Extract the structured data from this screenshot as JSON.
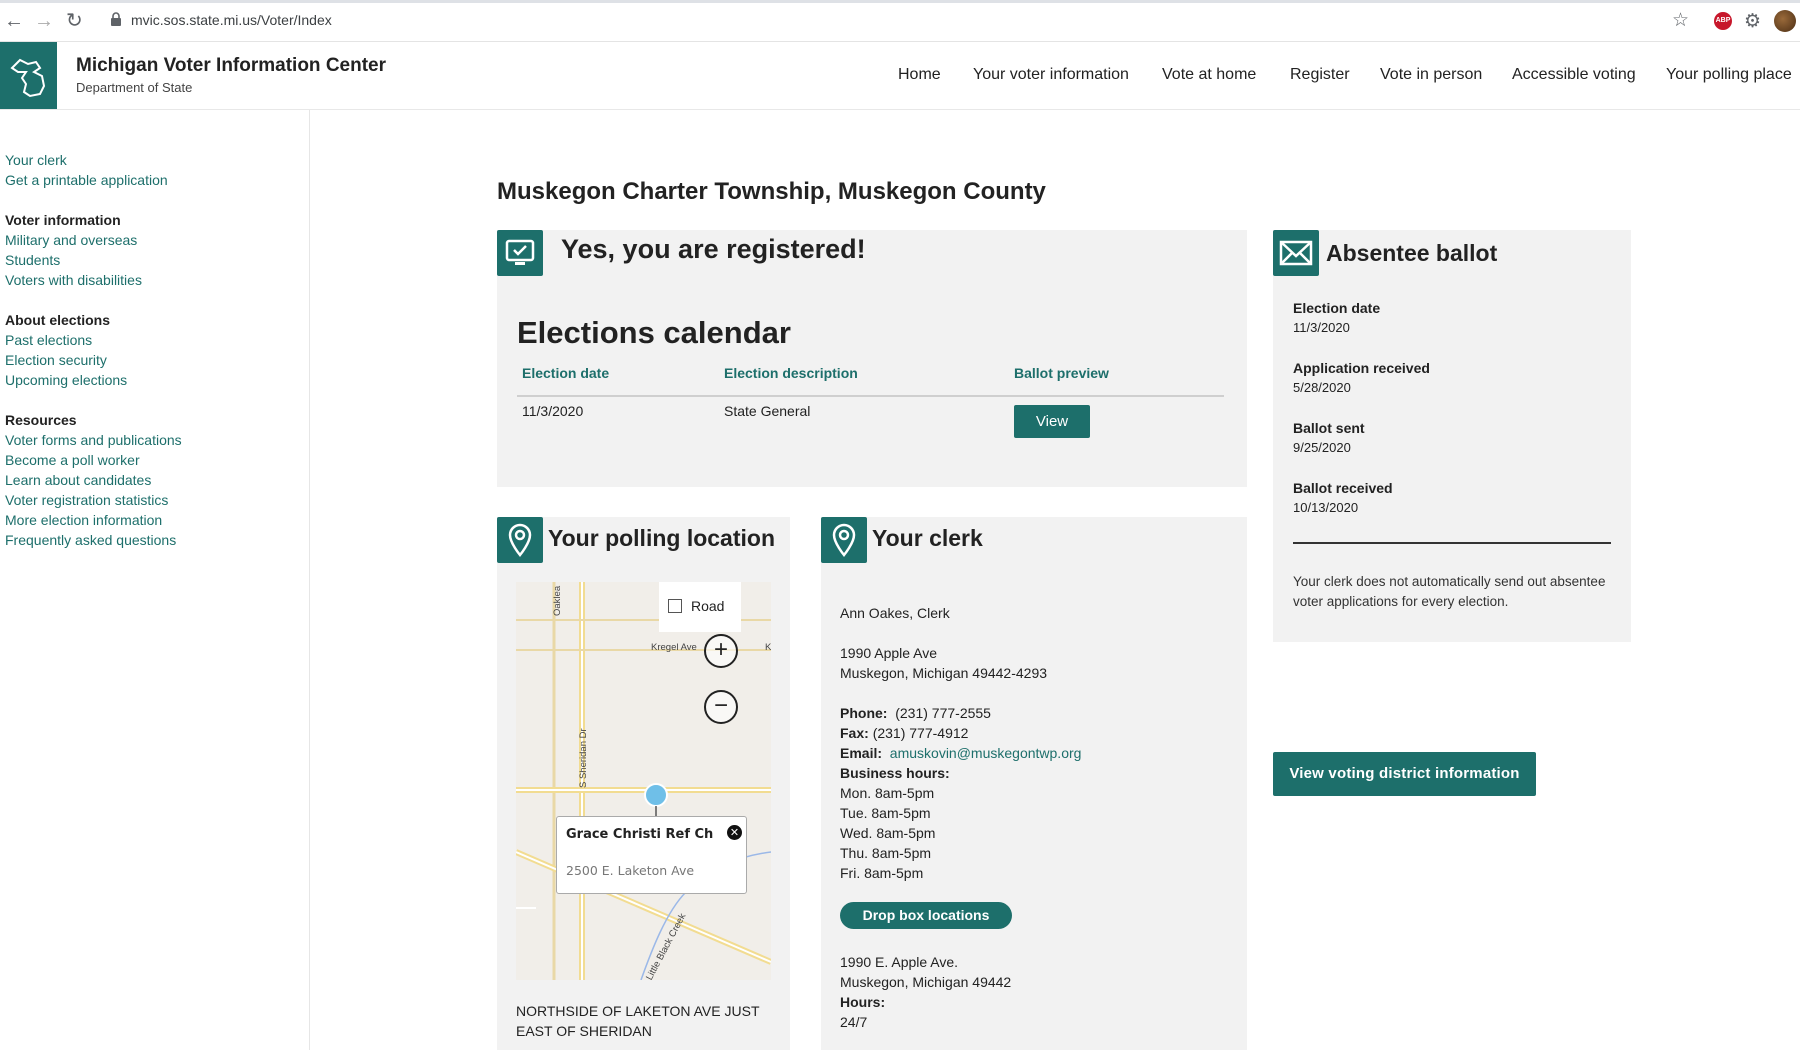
{
  "browser": {
    "url": "mvic.sos.state.mi.us/Voter/Index",
    "abp_label": "ABP"
  },
  "header": {
    "title": "Michigan Voter Information Center",
    "subtitle": "Department of State",
    "nav": [
      "Home",
      "Your voter information",
      "Vote at home",
      "Register",
      "Vote in person",
      "Accessible voting",
      "Your polling place"
    ]
  },
  "sidebar": {
    "top_links": [
      "Your clerk",
      "Get a printable application"
    ],
    "sections": [
      {
        "heading": "Voter information",
        "links": [
          "Military and overseas",
          "Students",
          "Voters with disabilities"
        ]
      },
      {
        "heading": "About elections",
        "links": [
          "Past elections",
          "Election security",
          "Upcoming elections"
        ]
      },
      {
        "heading": "Resources",
        "links": [
          "Voter forms and publications",
          "Become a poll worker",
          "Learn about candidates",
          "Voter registration statistics",
          "More election information",
          "Frequently asked questions"
        ]
      }
    ]
  },
  "page": {
    "title": "Muskegon Charter Township, Muskegon County"
  },
  "registration": {
    "title": "Yes, you are registered!",
    "calendar_title": "Elections calendar",
    "columns": [
      "Election date",
      "Election description",
      "Ballot preview"
    ],
    "rows": [
      {
        "date": "11/3/2020",
        "description": "State General",
        "action": "View"
      }
    ]
  },
  "absentee": {
    "title": "Absentee ballot",
    "fields": [
      {
        "label": "Election date",
        "value": "11/3/2020"
      },
      {
        "label": "Application received",
        "value": "5/28/2020"
      },
      {
        "label": "Ballot sent",
        "value": "9/25/2020"
      },
      {
        "label": "Ballot received",
        "value": "10/13/2020"
      }
    ],
    "note": "Your clerk does not automatically send out absentee voter applications for every election."
  },
  "district_button": "View voting district information",
  "polling": {
    "title": "Your polling location",
    "map": {
      "road_label": "Road",
      "zoom_in": "+",
      "zoom_out": "−",
      "street_labels": [
        "Kregel Ave",
        "S Sheridan Dr",
        "Oaklea",
        "Little Black Creek",
        "K"
      ],
      "popup_name": "Grace Christi Ref Ch",
      "popup_address": "2500 E. Laketon Ave",
      "popup_close": "✕"
    },
    "description": "NORTHSIDE OF LAKETON AVE JUST EAST OF SHERIDAN"
  },
  "clerk": {
    "title": "Your clerk",
    "name": "Ann Oakes, Clerk",
    "address_line1": "1990 Apple Ave",
    "address_line2": "Muskegon, Michigan 49442-4293",
    "phone_label": "Phone:",
    "phone": "(231) 777-2555",
    "fax_label": "Fax:",
    "fax": "(231) 777-4912",
    "email_label": "Email:",
    "email": "amuskovin@muskegontwp.org",
    "hours_label": "Business hours:",
    "hours": [
      "Mon. 8am-5pm",
      "Tue. 8am-5pm",
      "Wed. 8am-5pm",
      "Thu. 8am-5pm",
      "Fri. 8am-5pm"
    ],
    "dropbox_button": "Drop box locations",
    "dropbox_address1": "1990 E. Apple Ave.",
    "dropbox_address2": "Muskegon, Michigan 49442",
    "dropbox_hours_label": "Hours:",
    "dropbox_hours": "24/7"
  },
  "colors": {
    "brand": "#1d6f6b",
    "card_bg": "#f2f2f2"
  }
}
